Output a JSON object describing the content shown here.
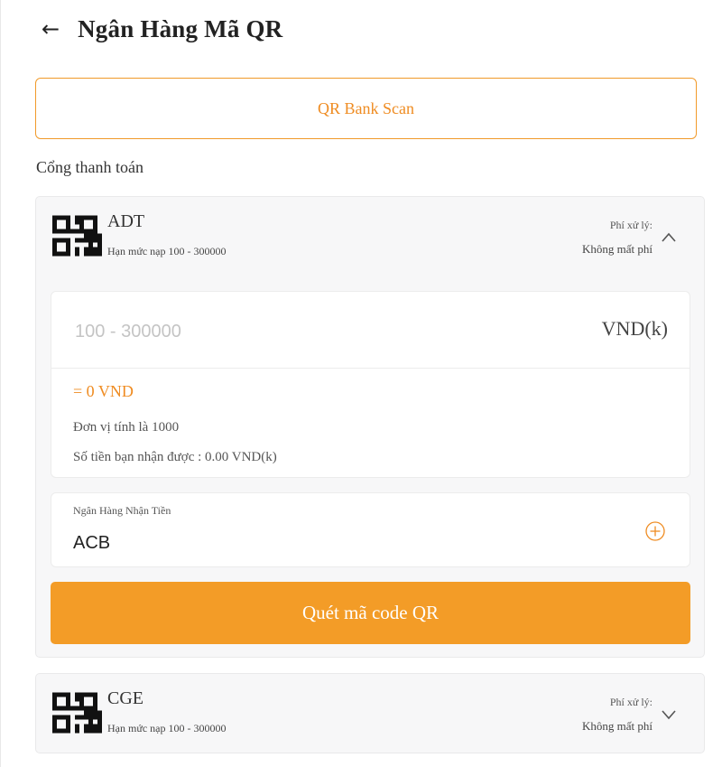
{
  "header": {
    "back_icon": "arrow-left-icon",
    "title": "Ngân Hàng Mã QR"
  },
  "scan_button": {
    "label": "QR Bank Scan"
  },
  "section_label": "Cổng thanh toán",
  "colors": {
    "accent": "#f39c27",
    "accent_text": "#ef8c22"
  },
  "gateways": [
    {
      "name": "ADT",
      "limit": "Hạn mức nạp 100 - 300000",
      "fee_label": "Phí xử lý:",
      "fee_value": "Không mất phí",
      "icon": "qr-code-icon",
      "expanded": true,
      "toggle_icon": "chevron-up-icon",
      "amount": {
        "value": "",
        "placeholder": "100 - 300000",
        "unit": "VND(k)",
        "converted": "= 0 VND",
        "unit_note": "Đơn vị tính là 1000",
        "receive": "Số tiền bạn nhận được : 0.00 VND(k)"
      },
      "bank": {
        "label": "Ngân Hàng Nhận Tiền",
        "value": "ACB",
        "add_icon": "plus-circle-icon"
      },
      "submit_label": "Quét mã code QR"
    },
    {
      "name": "CGE",
      "limit": "Hạn mức nạp 100 - 300000",
      "fee_label": "Phí xử lý:",
      "fee_value": "Không mất phí",
      "icon": "qr-code-icon",
      "expanded": false,
      "toggle_icon": "chevron-down-icon"
    }
  ]
}
